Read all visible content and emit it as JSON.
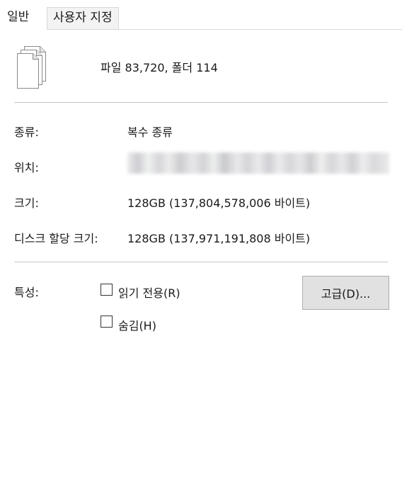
{
  "tabs": [
    {
      "label": "일반",
      "active": true
    },
    {
      "label": "사용자 지정",
      "active": false
    }
  ],
  "summary": {
    "icon": "multiple-files-icon",
    "text": "파일 83,720, 폴더 114"
  },
  "properties": {
    "type_label": "종류:",
    "type_value": "복수 종류",
    "location_label": "위치:",
    "size_label": "크기:",
    "size_value": "128GB (137,804,578,006 바이트)",
    "disk_size_label": "디스크 할당 크기:",
    "disk_size_value": "128GB (137,971,191,808 바이트)"
  },
  "attributes": {
    "label": "특성:",
    "readonly_label": "읽기 전용(R)",
    "readonly_checked": false,
    "hidden_label": "숨김(H)",
    "hidden_checked": false,
    "advanced_button": "고급(D)..."
  }
}
